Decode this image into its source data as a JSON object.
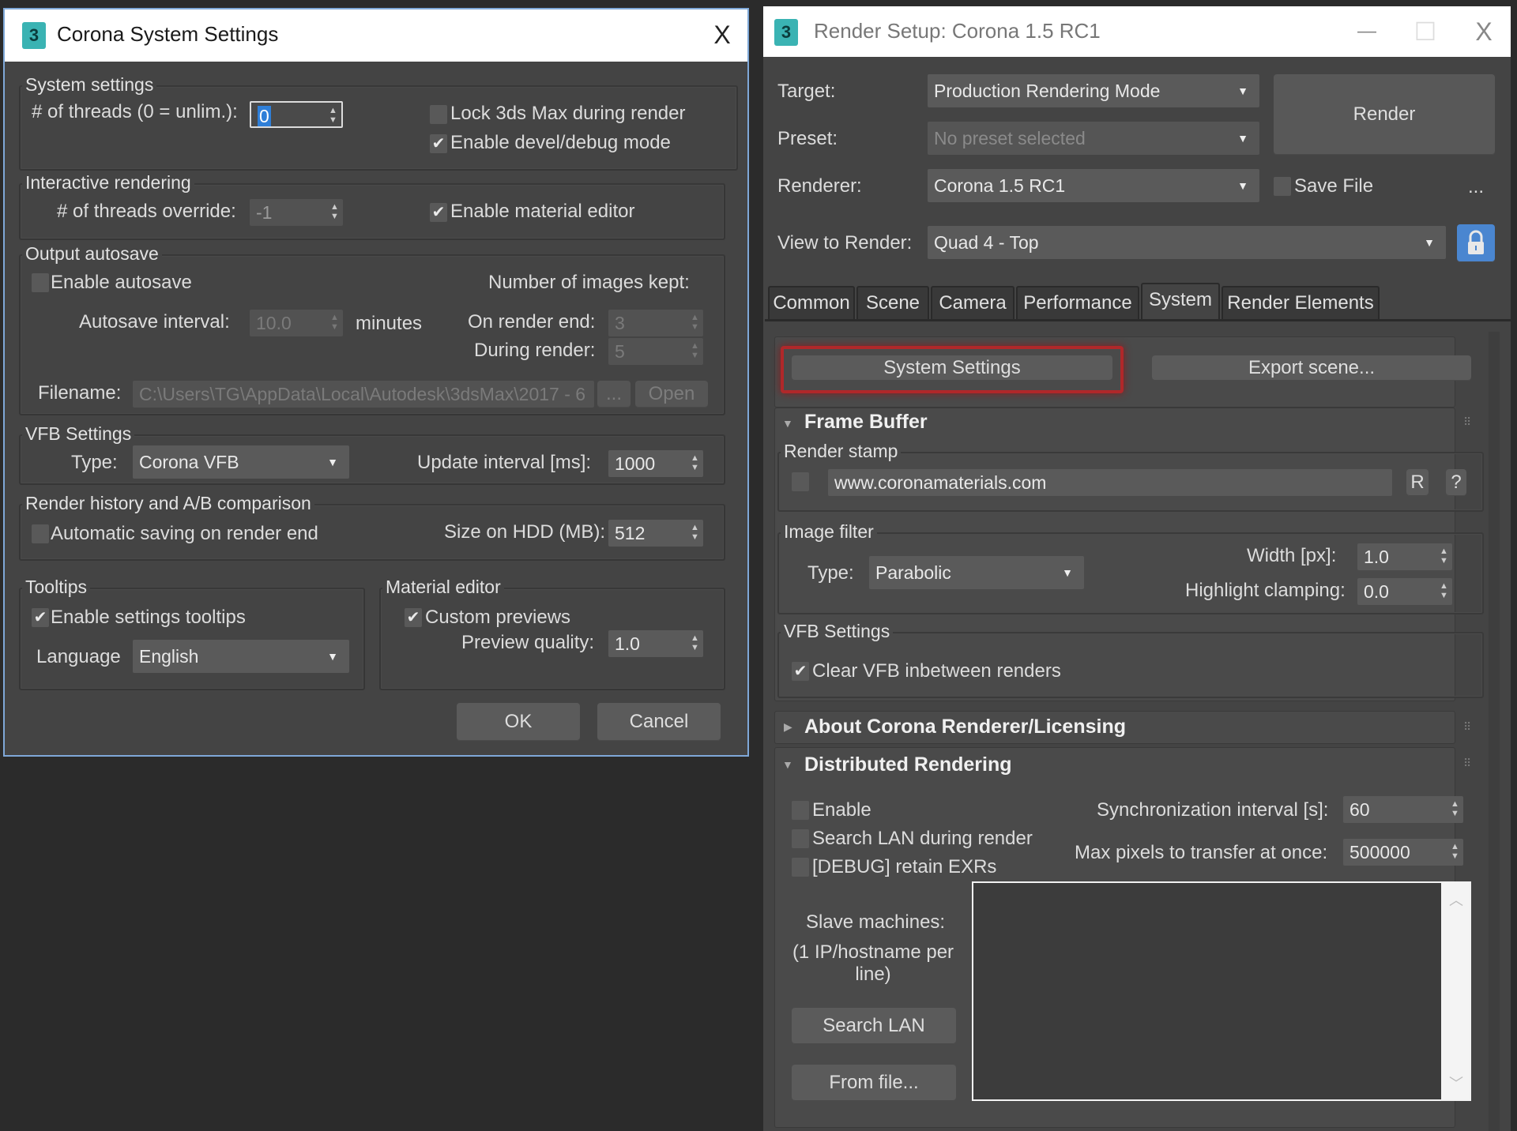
{
  "system_settings_dialog": {
    "title": "Corona System Settings",
    "app_icon": "3",
    "close_icon": "X",
    "system_settings": {
      "group_label": "System settings",
      "threads_label": "# of threads (0 = unlim.):",
      "threads_value": "0",
      "lock_max_label": "Lock 3ds Max during render",
      "lock_max_checked": false,
      "devel_debug_label": "Enable devel/debug mode",
      "devel_debug_checked": true
    },
    "interactive_rendering": {
      "group_label": "Interactive rendering",
      "threads_override_label": "# of threads override:",
      "threads_override_value": "-1",
      "material_editor_label": "Enable material editor",
      "material_editor_checked": true
    },
    "output_autosave": {
      "group_label": "Output autosave",
      "enable_label": "Enable autosave",
      "enable_checked": false,
      "images_kept_label": "Number of images kept:",
      "interval_label": "Autosave interval:",
      "interval_value": "10.0",
      "interval_unit": "minutes",
      "on_render_end_label": "On render end:",
      "on_render_end_value": "3",
      "during_render_label": "During render:",
      "during_render_value": "5",
      "filename_label": "Filename:",
      "filename_value": "C:\\Users\\TG\\AppData\\Local\\Autodesk\\3dsMax\\2017 - 6",
      "browse_label": "...",
      "open_label": "Open"
    },
    "vfb_settings": {
      "group_label": "VFB Settings",
      "type_label": "Type:",
      "type_value": "Corona VFB",
      "update_interval_label": "Update interval [ms]:",
      "update_interval_value": "1000"
    },
    "render_history": {
      "group_label": "Render history and A/B comparison",
      "auto_save_label": "Automatic saving on render end",
      "auto_save_checked": false,
      "size_label": "Size on HDD (MB):",
      "size_value": "512"
    },
    "tooltips": {
      "group_label": "Tooltips",
      "enable_label": "Enable settings tooltips",
      "enable_checked": true,
      "language_label": "Language",
      "language_value": "English"
    },
    "material_editor": {
      "group_label": "Material editor",
      "custom_previews_label": "Custom previews",
      "custom_previews_checked": true,
      "preview_quality_label": "Preview quality:",
      "preview_quality_value": "1.0"
    },
    "ok_label": "OK",
    "cancel_label": "Cancel"
  },
  "render_setup": {
    "title": "Render Setup: Corona 1.5 RC1",
    "app_icon": "3",
    "minimize_icon": "—",
    "maximize_icon": "☐",
    "close_icon": "X",
    "target_label": "Target:",
    "target_value": "Production Rendering Mode",
    "preset_label": "Preset:",
    "preset_value": "No preset selected",
    "renderer_label": "Renderer:",
    "renderer_value": "Corona 1.5 RC1",
    "render_button": "Render",
    "save_file_label": "Save File",
    "save_file_checked": false,
    "more_label": "...",
    "view_label": "View to Render:",
    "view_value": "Quad 4 - Top",
    "tabs": [
      "Common",
      "Scene",
      "Camera",
      "Performance",
      "System",
      "Render Elements"
    ],
    "active_tab": "System",
    "system_settings_button": "System Settings",
    "export_scene_button": "Export scene...",
    "highlight_color": "#b0282a",
    "frame_buffer": {
      "title": "Frame Buffer",
      "render_stamp_label": "Render stamp",
      "render_stamp_checked": false,
      "render_stamp_value": "www.coronamaterials.com",
      "r_button": "R",
      "help_button": "?",
      "image_filter_label": "Image filter",
      "type_label": "Type:",
      "type_value": "Parabolic",
      "width_label": "Width [px]:",
      "width_value": "1.0",
      "highlight_clamping_label": "Highlight clamping:",
      "highlight_clamping_value": "0.0",
      "vfb_settings_label": "VFB Settings",
      "clear_vfb_label": "Clear VFB inbetween renders",
      "clear_vfb_checked": true
    },
    "about": {
      "title": "About Corona Renderer/Licensing"
    },
    "distributed": {
      "title": "Distributed Rendering",
      "enable_label": "Enable",
      "search_lan_render_label": "Search LAN during render",
      "debug_exr_label": "[DEBUG] retain EXRs",
      "sync_label": "Synchronization interval [s]:",
      "sync_value": "60",
      "max_pixels_label": "Max pixels to transfer at once:",
      "max_pixels_value": "500000",
      "slave_label": "Slave machines:",
      "slave_hint": "(1 IP/hostname per line)",
      "search_lan_button": "Search LAN",
      "from_file_button": "From file...",
      "slave_list_value": ""
    }
  }
}
